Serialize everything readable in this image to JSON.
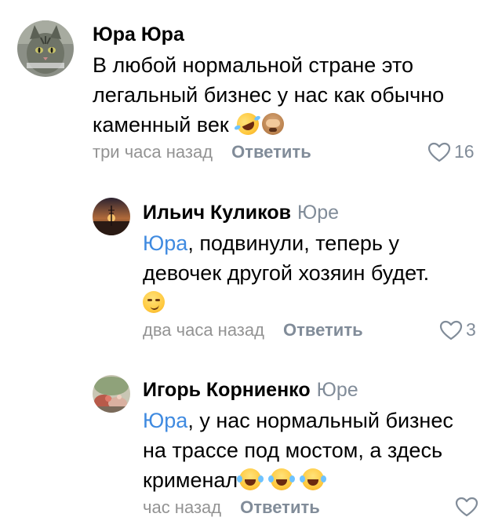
{
  "comments": [
    {
      "author": "Юра Юра",
      "reply_to": "",
      "mention": "",
      "lines": [
        "В любой нормальной стране это",
        "легальный бизнес у нас как обычно",
        "каменный век"
      ],
      "emojis": [
        "rolling-on-floor-laughing",
        "see-no-evil-monkey"
      ],
      "time": "три часа назад",
      "reply_label": "Ответить",
      "likes": "16"
    },
    {
      "author": "Ильич Куликов",
      "reply_to": "Юре",
      "mention": "Юра",
      "lines": [
        ", подвинули, теперь у",
        "девочек другой хозяин будет."
      ],
      "emojis": [
        "smirking-face"
      ],
      "time": "два часа назад",
      "reply_label": "Ответить",
      "likes": "3"
    },
    {
      "author": "Игорь Корниенко",
      "reply_to": "Юре",
      "mention": "Юра",
      "lines": [
        ", у нас нормальный бизнес",
        "на трассе под мостом, а здесь",
        "крименал"
      ],
      "emojis": [
        "face-with-tears-of-joy",
        "face-with-tears-of-joy",
        "face-with-tears-of-joy"
      ],
      "time": "час назад",
      "reply_label": "Ответить",
      "likes": ""
    }
  ],
  "colors": {
    "text": "#000000",
    "secondary": "#939393",
    "action": "#818c99",
    "mention": "#3f8ae0"
  },
  "icons": {
    "like": "heart-outline-icon"
  }
}
